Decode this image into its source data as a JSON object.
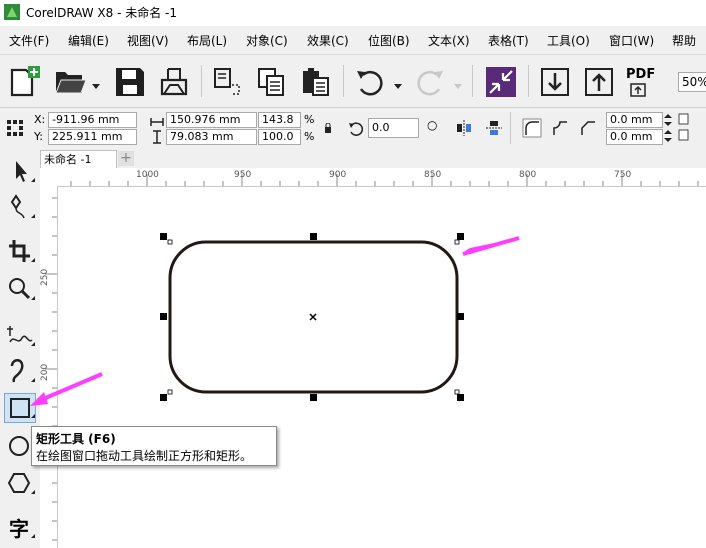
{
  "window": {
    "title": "CorelDRAW X8 - 未命名 -1"
  },
  "menu": [
    "文件(F)",
    "编辑(E)",
    "视图(V)",
    "布局(L)",
    "对象(C)",
    "效果(C)",
    "位图(B)",
    "文本(X)",
    "表格(T)",
    "工具(O)",
    "窗口(W)",
    "帮助"
  ],
  "toolbar": {
    "pdf_label": "PDF",
    "zoom": "50%"
  },
  "properties": {
    "x_label": "X:",
    "x": "-911.96 mm",
    "y_label": "Y:",
    "y": "225.911 mm",
    "width": "150.976 mm",
    "height": "79.083 mm",
    "scale_x": "143.8",
    "scale_y": "100.0",
    "percent": "%",
    "rotation": "0.0",
    "corner_1": "0.0 mm",
    "corner_2": "0.0 mm"
  },
  "document": {
    "tab": "未命名 -1",
    "add_tab": "+"
  },
  "ruler": {
    "h_ticks": [
      "1000",
      "950",
      "900",
      "850",
      "800",
      "750"
    ],
    "v_ticks": [
      "250",
      "200"
    ]
  },
  "tooltip": {
    "title": "矩形工具 (F6)",
    "body": "在绘图窗口拖动工具绘制正方形和矩形。"
  },
  "colors": {
    "arrow": "#ff3dff",
    "shape": "#231815",
    "shrink_icon": "#5a2a7a"
  }
}
